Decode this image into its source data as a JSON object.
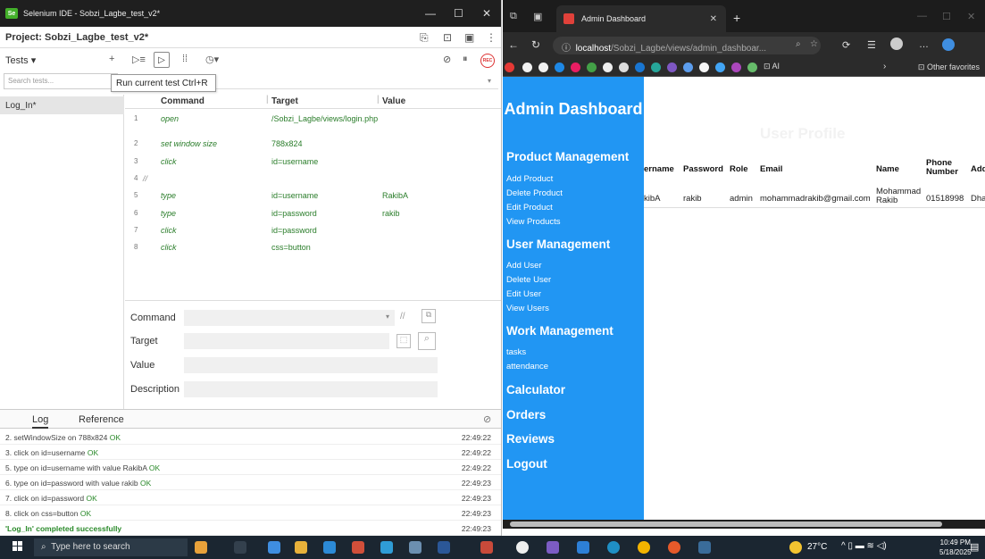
{
  "ide": {
    "window_title": "Selenium IDE - Sobzi_Lagbe_test_v2*",
    "project_label": "Project:  Sobzi_Lagbe_test_v2*",
    "tests_dropdown": "Tests",
    "search_placeholder": "Search tests...",
    "tooltip": "Run current test  Ctrl+R",
    "test_name": "Log_In*",
    "headers": {
      "command": "Command",
      "target": "Target",
      "value": "Value"
    },
    "commands": [
      {
        "n": "1",
        "cmd": "open",
        "target": "/Sobzi_Lagbe/views/login.php",
        "value": ""
      },
      {
        "n": "2",
        "cmd": "set window size",
        "target": "788x824",
        "value": ""
      },
      {
        "n": "3",
        "cmd": "click",
        "target": "id=username",
        "value": ""
      },
      {
        "n": "4",
        "cmd": "//",
        "target": "",
        "value": ""
      },
      {
        "n": "5",
        "cmd": "type",
        "target": "id=username",
        "value": "RakibA"
      },
      {
        "n": "6",
        "cmd": "type",
        "target": "id=password",
        "value": "rakib"
      },
      {
        "n": "7",
        "cmd": "click",
        "target": "id=password",
        "value": ""
      },
      {
        "n": "8",
        "cmd": "click",
        "target": "css=button",
        "value": ""
      }
    ],
    "form": {
      "command": "Command",
      "target": "Target",
      "value": "Value",
      "description": "Description"
    },
    "log_tabs": [
      "Log",
      "Reference"
    ],
    "log": [
      {
        "text": "2.  setWindowSize on 788x824 ",
        "status": "OK",
        "time": "22:49:22"
      },
      {
        "text": "3.  click on id=username ",
        "status": "OK",
        "time": "22:49:22"
      },
      {
        "text": "5.  type on id=username with value RakibA ",
        "status": "OK",
        "time": "22:49:22"
      },
      {
        "text": "6.  type on id=password with value rakib ",
        "status": "OK",
        "time": "22:49:23"
      },
      {
        "text": "7.  click on id=password ",
        "status": "OK",
        "time": "22:49:23"
      },
      {
        "text": "8.  click on css=button ",
        "status": "OK",
        "time": "22:49:23"
      }
    ],
    "log_final": {
      "text": "'Log_In' completed successfully",
      "time": "22:49:23"
    }
  },
  "browser": {
    "tab_title": "Admin Dashboard",
    "address_host": "localhost",
    "address_path": "/Sobzi_Lagbe/views/admin_dashboar...",
    "other_favorites": "Other favorites",
    "sidebar": {
      "title": "Admin Dashboard",
      "sections": [
        {
          "heading": "Product Management",
          "links": [
            "Add Product",
            "Delete Product",
            "Edit Product",
            "View Products"
          ]
        },
        {
          "heading": "User Management",
          "links": [
            "Add User",
            "Delete User",
            "Edit User",
            "View Users"
          ]
        },
        {
          "heading": "Work Management",
          "links": [
            "tasks",
            "attendance"
          ]
        }
      ],
      "extra": [
        "Calculator",
        "Orders",
        "Reviews",
        "Logout"
      ]
    },
    "content": {
      "heading": "User Profile",
      "headers": [
        "ername",
        "Password",
        "Role",
        "Email",
        "Name",
        "Phone Number",
        "Add"
      ],
      "row": [
        "kibA",
        "rakib",
        "admin",
        "mohammadrakib@gmail.com",
        "Mohammad Rakib",
        "01518998",
        "Dha"
      ]
    }
  },
  "taskbar": {
    "search_placeholder": "Type here to search",
    "temperature": "27°C",
    "time": "10:49 PM",
    "date": "5/18/2025"
  },
  "colors": {
    "sidebar": "#2196f3",
    "ok_green": "#2a8a2a",
    "command_green": "#2a7d2a",
    "taskbar": "#1b2631"
  }
}
